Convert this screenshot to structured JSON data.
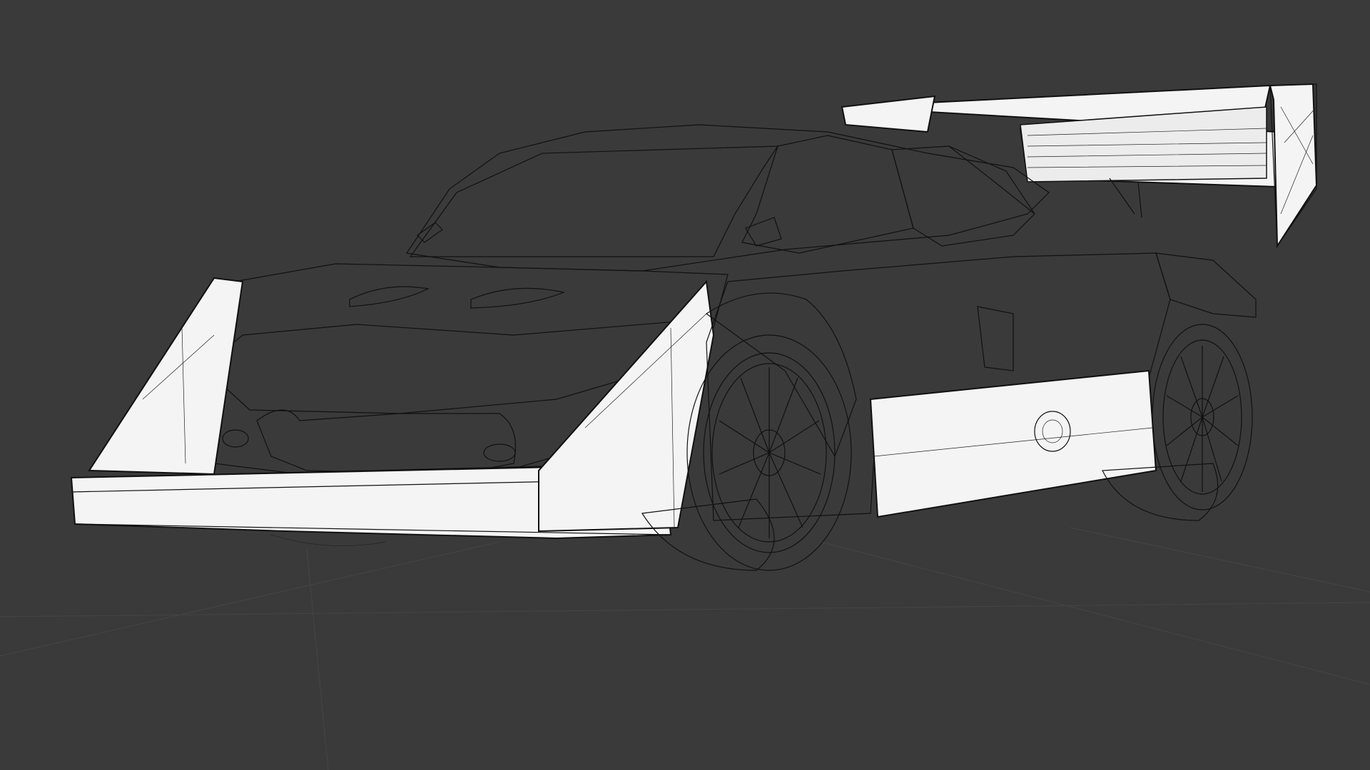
{
  "viewport": {
    "mode": "wireframe",
    "background_color": "#3a3a3a",
    "grid_color": "#454545",
    "wire_color": "#111111",
    "surface_color": "#f4f4f4"
  },
  "scene": {
    "object": "race-car-wireframe-model"
  }
}
